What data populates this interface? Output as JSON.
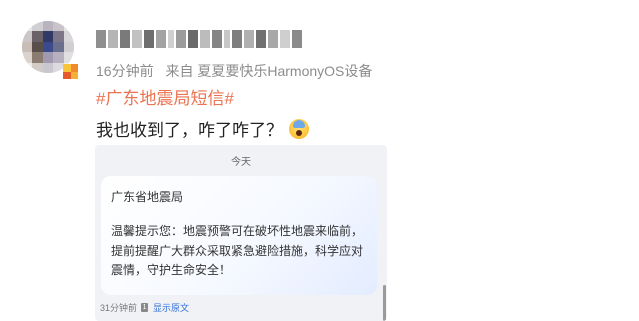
{
  "post": {
    "time_ago": "16分钟前",
    "source_prefix": "来自",
    "source_device": "夏夏要快乐HarmonyOS设备",
    "topic": "#广东地震局短信#",
    "text": "我也收到了，咋了咋了？",
    "emoji_icon": "scared-face-icon",
    "username_blurred": true
  },
  "sms_screenshot": {
    "day_label": "今天",
    "sender": "广东省地震局",
    "message": "温馨提示您：地震预警可在破坏性地震来临前，提前提醒广大群众采取紧急避险措施，科学应对震情，守护生命安全！",
    "time_ago": "31分钟前",
    "sim_badge": "1",
    "view_original_label": "显示原文"
  },
  "colors": {
    "topic": "#eb7350",
    "meta": "#8c8c8c",
    "link": "#2f6fd6"
  }
}
